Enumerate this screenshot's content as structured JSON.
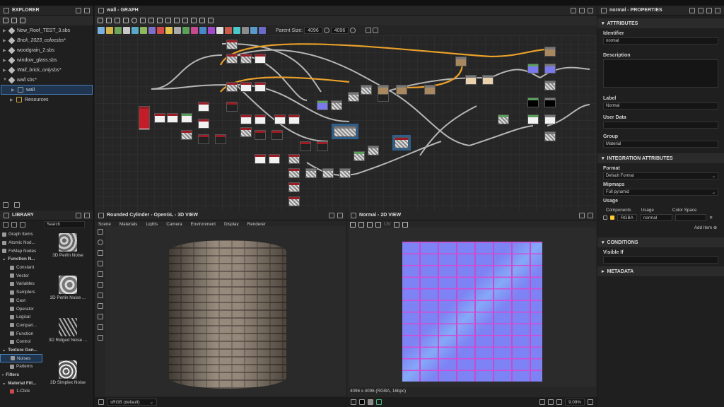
{
  "explorer": {
    "title": "EXPLORER",
    "files": [
      {
        "label": "New_Roof_TEST_3.sbs"
      },
      {
        "label": "Brick_2023_colocsbs*"
      },
      {
        "label": "woodgrain_2.sbs"
      },
      {
        "label": "window_glass.sbs"
      },
      {
        "label": "Wall_brick_onlysbs*"
      },
      {
        "label": "wall.sbs*"
      }
    ],
    "graph_item": "wall",
    "resources": "Resources"
  },
  "graph": {
    "title": "wall - GRAPH",
    "parent_size_label": "Parent Size:",
    "parent_size": "4096",
    "size2": "4096"
  },
  "props": {
    "title": "normal - PROPERTIES",
    "attributes": "ATTRIBUTES",
    "identifier_label": "Identifier",
    "identifier": "normal",
    "description_label": "Description",
    "label_label": "Label",
    "label": "Normal",
    "user_data_label": "User Data",
    "group_label": "Group",
    "group": "Material",
    "integration": "INTEGRATION ATTRIBUTES",
    "format_label": "Format",
    "format": "Default Format",
    "mipmaps_label": "Mipmaps",
    "mipmaps": "Full pyramid",
    "usage_label": "Usage",
    "components_label": "Components",
    "usage_col": "Usage",
    "color_space_col": "Color Space",
    "components": "RGBA",
    "usage": "normal",
    "add_item": "Add Item",
    "conditions": "CONDITIONS",
    "visible_if": "Visible If",
    "metadata": "METADATA"
  },
  "library": {
    "title": "LIBRARY",
    "search": "Search",
    "tree": [
      {
        "label": "Graph Items"
      },
      {
        "label": "Atomic Nod..."
      },
      {
        "label": "FxMap Nodes"
      },
      {
        "label": "Function N..."
      },
      {
        "label": "Constant"
      },
      {
        "label": "Vector"
      },
      {
        "label": "Variables"
      },
      {
        "label": "Samplers"
      },
      {
        "label": "Cast"
      },
      {
        "label": "Operator"
      },
      {
        "label": "Logical"
      },
      {
        "label": "Compari..."
      },
      {
        "label": "Function"
      },
      {
        "label": "Control"
      },
      {
        "label": "Texture Gen..."
      },
      {
        "label": "Noises"
      },
      {
        "label": "Patterns"
      },
      {
        "label": "Filters"
      },
      {
        "label": "Material Filt..."
      },
      {
        "label": "1-Click"
      }
    ],
    "items": [
      {
        "label": "3D Perlin Noise"
      },
      {
        "label": "3D Perlin Noise ..."
      },
      {
        "label": "3D Ridged Noise ..."
      },
      {
        "label": "3D Simplex Noise"
      }
    ]
  },
  "view3d": {
    "title": "Rounded Cylinder - OpenGL - 3D VIEW",
    "menu": [
      "Scene",
      "Materials",
      "Lights",
      "Camera",
      "Environment",
      "Display",
      "Renderer"
    ],
    "colorspace": "sRGB (default)"
  },
  "view2d": {
    "title": "Normal - 2D VIEW",
    "uv": "UV",
    "info": "4096 x 4096 (RGBA, 16bpc)",
    "zoom": "9.09%"
  }
}
